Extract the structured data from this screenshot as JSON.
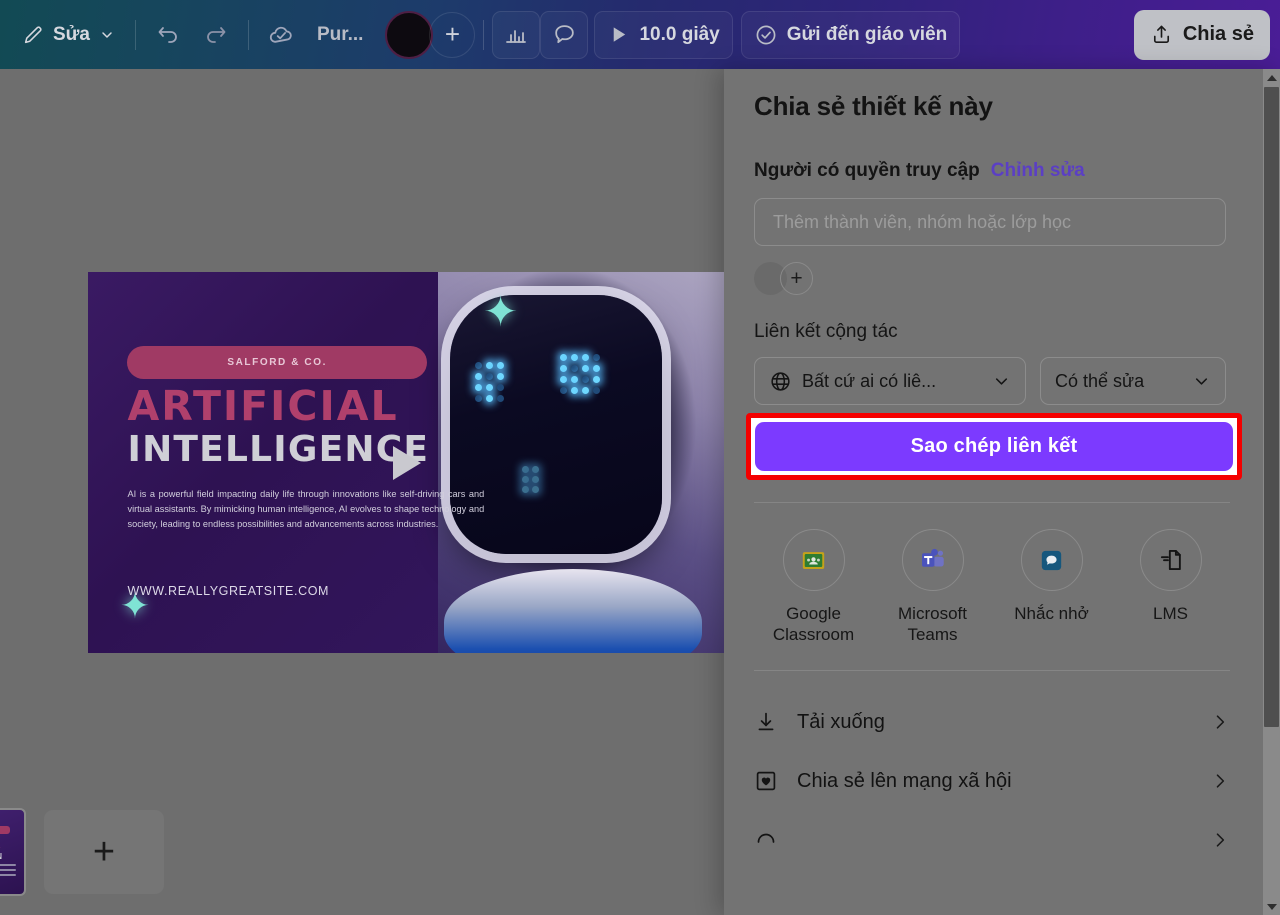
{
  "toolbar": {
    "edit_label": "Sửa",
    "edit_icon": "pencil-icon",
    "chevron_icon": "chevron-down-icon",
    "undo_icon": "undo-icon",
    "redo_icon": "redo-icon",
    "cloud_save_icon": "cloud-check-icon",
    "doc_title": "Pur...",
    "color_swatch": "#0d0a10",
    "add_color_label": "+",
    "analytics_icon": "bar-chart-icon",
    "comment_icon": "comment-bubble-icon",
    "play_icon": "play-icon",
    "duration_label": "10.0 giây",
    "send_teacher_icon": "check-circle-icon",
    "send_teacher_label": "Gửi đến giáo viên",
    "share_icon": "share-upload-icon",
    "share_label": "Chia sẻ"
  },
  "canvas": {
    "design": {
      "brand_pill": "SALFORD & CO.",
      "headline_line1": "ARTIFICIAL",
      "headline_line2": "INTELLIGENCE",
      "body": "AI is a powerful field impacting daily life through innovations like self-driving cars and virtual assistants. By mimicking human intelligence, AI evolves to shape technology and society, leading to endless possibilities and advancements across industries.",
      "website": "WWW.REALLYGREATSITE.COM",
      "play_overlay_icon": "play-icon",
      "sparkle_icon": "four-point-star-icon",
      "colors": {
        "background": "#2e1252",
        "headline_pink": "#b0406c",
        "headline_grey": "#cfcfd6",
        "pill": "#a03a64",
        "sparkle": "#7fe3d4"
      }
    },
    "add_page_label": "+"
  },
  "share_panel": {
    "title": "Chia sẻ thiết kế này",
    "access": {
      "label": "Người có quyền truy cập",
      "edit_link": "Chỉnh sửa",
      "edit_link_color": "#5b3fc4",
      "input_placeholder": "Thêm thành viên, nhóm hoặc lớp học",
      "input_value": "",
      "avatar_icon": "avatar",
      "add_member_label": "+"
    },
    "collab": {
      "section_title": "Liên kết cộng tác",
      "visibility_icon": "globe-icon",
      "visibility_value": "Bất cứ ai có liê...",
      "permission_value": "Có thể sửa",
      "chevron_icon": "chevron-down-icon",
      "copy_button_label": "Sao chép liên kết",
      "copy_button_color": "#7c3aff",
      "highlight_color": "#f40000"
    },
    "apps": [
      {
        "label": "Google\nClassroom",
        "icon": "google-classroom-icon"
      },
      {
        "label": "Microsoft\nTeams",
        "icon": "microsoft-teams-icon"
      },
      {
        "label": "Nhắc nhở",
        "icon": "remind-icon"
      },
      {
        "label": "LMS",
        "icon": "lms-document-icon"
      }
    ],
    "menu": [
      {
        "label": "Tải xuống",
        "icon": "download-icon",
        "caret": "chevron-right-icon"
      },
      {
        "label": "Chia sẻ lên mạng xã hội",
        "icon": "heart-square-icon",
        "caret": "chevron-right-icon"
      },
      {
        "label": "",
        "icon": "partial-icon",
        "caret": "chevron-right-icon"
      }
    ],
    "scrollbar": {
      "up_icon": "scroll-up-arrow",
      "down_icon": "scroll-down-arrow"
    }
  }
}
